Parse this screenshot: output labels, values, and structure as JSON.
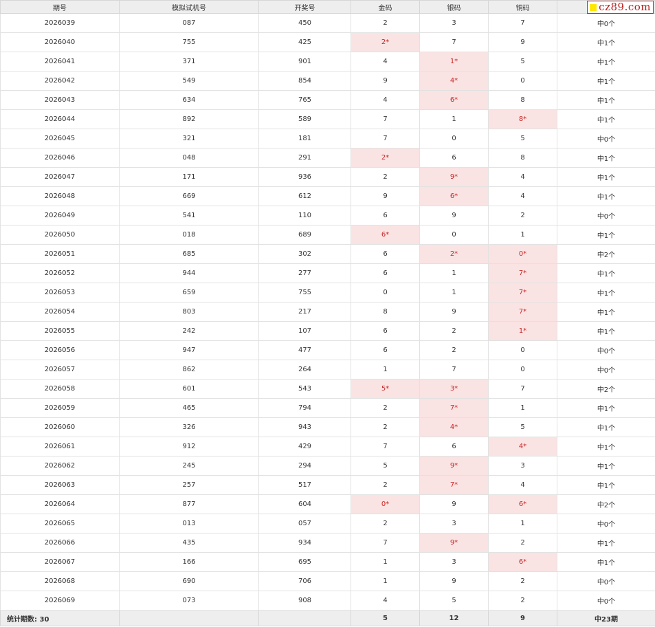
{
  "headers": [
    "期号",
    "模拟试机号",
    "开奖号",
    "金码",
    "银码",
    "铜码",
    ""
  ],
  "rows": [
    {
      "issue": "2026039",
      "sim": "087",
      "draw": "450",
      "gold": "2",
      "silver": "3",
      "copper": "7",
      "result": "中0个",
      "hits": []
    },
    {
      "issue": "2026040",
      "sim": "755",
      "draw": "425",
      "gold": "2*",
      "silver": "7",
      "copper": "9",
      "result": "中1个",
      "hits": [
        "gold"
      ]
    },
    {
      "issue": "2026041",
      "sim": "371",
      "draw": "901",
      "gold": "4",
      "silver": "1*",
      "copper": "5",
      "result": "中1个",
      "hits": [
        "silver"
      ]
    },
    {
      "issue": "2026042",
      "sim": "549",
      "draw": "854",
      "gold": "9",
      "silver": "4*",
      "copper": "0",
      "result": "中1个",
      "hits": [
        "silver"
      ]
    },
    {
      "issue": "2026043",
      "sim": "634",
      "draw": "765",
      "gold": "4",
      "silver": "6*",
      "copper": "8",
      "result": "中1个",
      "hits": [
        "silver"
      ]
    },
    {
      "issue": "2026044",
      "sim": "892",
      "draw": "589",
      "gold": "7",
      "silver": "1",
      "copper": "8*",
      "result": "中1个",
      "hits": [
        "copper"
      ]
    },
    {
      "issue": "2026045",
      "sim": "321",
      "draw": "181",
      "gold": "7",
      "silver": "0",
      "copper": "5",
      "result": "中0个",
      "hits": []
    },
    {
      "issue": "2026046",
      "sim": "048",
      "draw": "291",
      "gold": "2*",
      "silver": "6",
      "copper": "8",
      "result": "中1个",
      "hits": [
        "gold"
      ]
    },
    {
      "issue": "2026047",
      "sim": "171",
      "draw": "936",
      "gold": "2",
      "silver": "9*",
      "copper": "4",
      "result": "中1个",
      "hits": [
        "silver"
      ]
    },
    {
      "issue": "2026048",
      "sim": "669",
      "draw": "612",
      "gold": "9",
      "silver": "6*",
      "copper": "4",
      "result": "中1个",
      "hits": [
        "silver"
      ]
    },
    {
      "issue": "2026049",
      "sim": "541",
      "draw": "110",
      "gold": "6",
      "silver": "9",
      "copper": "2",
      "result": "中0个",
      "hits": []
    },
    {
      "issue": "2026050",
      "sim": "018",
      "draw": "689",
      "gold": "6*",
      "silver": "0",
      "copper": "1",
      "result": "中1个",
      "hits": [
        "gold"
      ]
    },
    {
      "issue": "2026051",
      "sim": "685",
      "draw": "302",
      "gold": "6",
      "silver": "2*",
      "copper": "0*",
      "result": "中2个",
      "hits": [
        "silver",
        "copper"
      ]
    },
    {
      "issue": "2026052",
      "sim": "944",
      "draw": "277",
      "gold": "6",
      "silver": "1",
      "copper": "7*",
      "result": "中1个",
      "hits": [
        "copper"
      ]
    },
    {
      "issue": "2026053",
      "sim": "659",
      "draw": "755",
      "gold": "0",
      "silver": "1",
      "copper": "7*",
      "result": "中1个",
      "hits": [
        "copper"
      ]
    },
    {
      "issue": "2026054",
      "sim": "803",
      "draw": "217",
      "gold": "8",
      "silver": "9",
      "copper": "7*",
      "result": "中1个",
      "hits": [
        "copper"
      ]
    },
    {
      "issue": "2026055",
      "sim": "242",
      "draw": "107",
      "gold": "6",
      "silver": "2",
      "copper": "1*",
      "result": "中1个",
      "hits": [
        "copper"
      ]
    },
    {
      "issue": "2026056",
      "sim": "947",
      "draw": "477",
      "gold": "6",
      "silver": "2",
      "copper": "0",
      "result": "中0个",
      "hits": []
    },
    {
      "issue": "2026057",
      "sim": "862",
      "draw": "264",
      "gold": "1",
      "silver": "7",
      "copper": "0",
      "result": "中0个",
      "hits": []
    },
    {
      "issue": "2026058",
      "sim": "601",
      "draw": "543",
      "gold": "5*",
      "silver": "3*",
      "copper": "7",
      "result": "中2个",
      "hits": [
        "gold",
        "silver"
      ]
    },
    {
      "issue": "2026059",
      "sim": "465",
      "draw": "794",
      "gold": "2",
      "silver": "7*",
      "copper": "1",
      "result": "中1个",
      "hits": [
        "silver"
      ]
    },
    {
      "issue": "2026060",
      "sim": "326",
      "draw": "943",
      "gold": "2",
      "silver": "4*",
      "copper": "5",
      "result": "中1个",
      "hits": [
        "silver"
      ]
    },
    {
      "issue": "2026061",
      "sim": "912",
      "draw": "429",
      "gold": "7",
      "silver": "6",
      "copper": "4*",
      "result": "中1个",
      "hits": [
        "copper"
      ]
    },
    {
      "issue": "2026062",
      "sim": "245",
      "draw": "294",
      "gold": "5",
      "silver": "9*",
      "copper": "3",
      "result": "中1个",
      "hits": [
        "silver"
      ]
    },
    {
      "issue": "2026063",
      "sim": "257",
      "draw": "517",
      "gold": "2",
      "silver": "7*",
      "copper": "4",
      "result": "中1个",
      "hits": [
        "silver"
      ]
    },
    {
      "issue": "2026064",
      "sim": "877",
      "draw": "604",
      "gold": "0*",
      "silver": "9",
      "copper": "6*",
      "result": "中2个",
      "hits": [
        "gold",
        "copper"
      ]
    },
    {
      "issue": "2026065",
      "sim": "013",
      "draw": "057",
      "gold": "2",
      "silver": "3",
      "copper": "1",
      "result": "中0个",
      "hits": []
    },
    {
      "issue": "2026066",
      "sim": "435",
      "draw": "934",
      "gold": "7",
      "silver": "9*",
      "copper": "2",
      "result": "中1个",
      "hits": [
        "silver"
      ]
    },
    {
      "issue": "2026067",
      "sim": "166",
      "draw": "695",
      "gold": "1",
      "silver": "3",
      "copper": "6*",
      "result": "中1个",
      "hits": [
        "copper"
      ]
    },
    {
      "issue": "2026068",
      "sim": "690",
      "draw": "706",
      "gold": "1",
      "silver": "9",
      "copper": "2",
      "result": "中0个",
      "hits": []
    },
    {
      "issue": "2026069",
      "sim": "073",
      "draw": "908",
      "gold": "4",
      "silver": "5",
      "copper": "2",
      "result": "中0个",
      "hits": []
    }
  ],
  "footer": {
    "label": "统计期数: 30",
    "gold": "5",
    "silver": "12",
    "copper": "9",
    "result": "中23期"
  },
  "watermark": {
    "text": "cz89.com",
    "square_color": "#ffe800",
    "text_color": "#b71c1c"
  },
  "colors": {
    "hit_bg": "#fae3e3",
    "hit_text": "#c62828",
    "header_bg": "#eeeeee"
  }
}
